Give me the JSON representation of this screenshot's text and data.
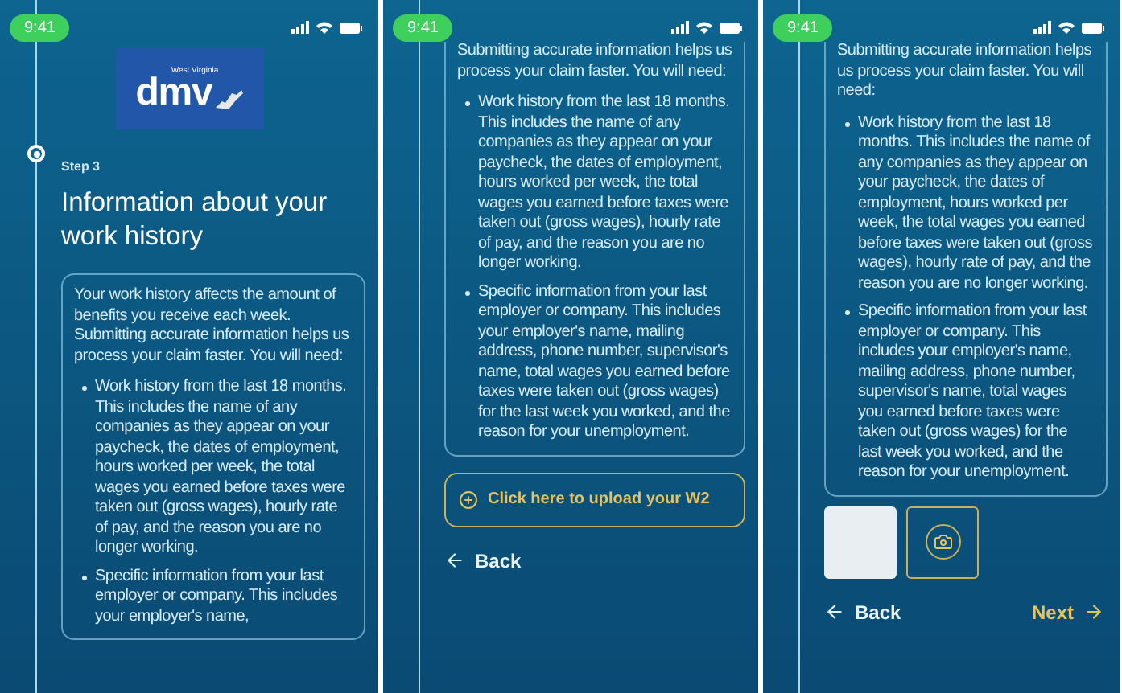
{
  "screens": [
    {
      "kind": "intro",
      "status_time": "9:41",
      "logo": {
        "small": "West Virginia",
        "big": "dmv"
      },
      "step": "Step 3",
      "title": "Information about your work history",
      "intro": "Your work history affects the amount of benefits you receive each week. Submitting accurate information helps us process your claim faster. You will need:",
      "bullets": [
        "Work history from the last 18 months. This includes the name of any companies as they appear on your paycheck, the dates of employment, hours worked per week, the total wages you earned before taxes were taken out (gross wages), hourly rate of pay, and the reason you are no longer working.",
        "Specific information from your last employer or company. This includes your employer's name,"
      ]
    },
    {
      "kind": "upload",
      "status_time": "9:41",
      "intro": "Submitting accurate information helps us process your claim faster. You will need:",
      "bullets": [
        "Work history from the last 18 months. This includes the name of any companies as they appear on your paycheck, the dates of employment, hours worked per week, the total wages you earned before taxes were taken out (gross wages), hourly rate of pay, and the reason you are no longer working.",
        "Specific information from your last employer or company. This includes your employer's name, mailing address, phone number, supervisor's name, total wages you earned before taxes were taken out (gross wages) for the last week you worked, and the reason for your unemployment."
      ],
      "upload_button": "Click here to upload your W2",
      "back": "Back"
    },
    {
      "kind": "attached",
      "status_time": "9:41",
      "intro": "Submitting accurate information helps us process your claim faster. You will need:",
      "bullets": [
        "Work history from the last 18 months. This includes the name of any companies as they appear on your paycheck, the dates of employment, hours worked per week, the total wages you earned before taxes were taken out (gross wages), hourly rate of pay, and the reason you are no longer working.",
        "Specific information from your last employer or company. This includes your employer's name, mailing address, phone number, supervisor's name, total wages you earned before taxes were taken out (gross wages) for the last week you worked, and the reason for your unemployment."
      ],
      "back": "Back",
      "next": "Next"
    }
  ]
}
